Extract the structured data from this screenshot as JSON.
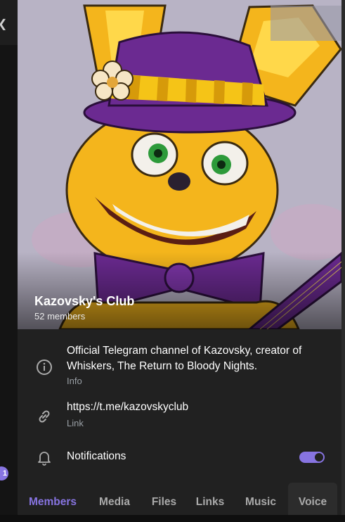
{
  "channel": {
    "title": "Kazovsky's Club",
    "members": "52 members"
  },
  "info": {
    "description": "Official Telegram channel of Kazovsky, creator of Whiskers, The Return to Bloody Nights.",
    "description_label": "Info",
    "link": "https://t.me/kazovskyclub",
    "link_label": "Link",
    "notifications_label": "Notifications",
    "notifications_enabled": true
  },
  "tabs": [
    {
      "label": "Members",
      "active": true
    },
    {
      "label": "Media",
      "active": false
    },
    {
      "label": "Files",
      "active": false
    },
    {
      "label": "Links",
      "active": false
    },
    {
      "label": "Music",
      "active": false
    },
    {
      "label": "Voice",
      "active": false
    }
  ],
  "sidebar": {
    "unread_badge": "1"
  },
  "colors": {
    "accent": "#8774e1",
    "panel_bg": "#212121",
    "secondary_text": "#9aa0a6"
  },
  "icons": [
    "info-icon",
    "link-icon",
    "bell-icon",
    "menu-icon"
  ]
}
